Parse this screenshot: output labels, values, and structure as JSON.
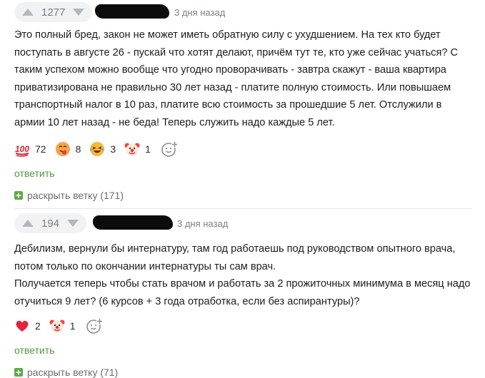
{
  "comments": [
    {
      "rating": "1277",
      "time": "3 дня назад",
      "text": "Это полный бред, закон не может иметь обратную силу с ухудшением. На тех кто будет поступать в августе 26 - пускай что хотят делают, причём тут те, кто уже сейчас учаться? С таким успехом можно вообще что угодно проворачивать - завтра скажут - ваша квартира приватизирована не правильно 30 лет назад - платите полную стоимость. Или повышаем транспортный налог в 10 раз, платите всю стоимость за прошедшие 5 лет. Отслужили в армии 10 лет назад - не беда! Теперь служить надо каждые 5 лет.",
      "reactions": [
        {
          "icon": "hundred-icon",
          "count": "72"
        },
        {
          "icon": "tongue-face-icon",
          "count": "8"
        },
        {
          "icon": "laughing-face-icon",
          "count": "3"
        },
        {
          "icon": "clown-face-icon",
          "count": "1"
        }
      ],
      "reply_label": "ответить",
      "expand_label": "раскрыть ветку (171)"
    },
    {
      "rating": "194",
      "time": "3 дня назад",
      "text_lines": [
        "Дебилизм, вернули бы интернатуру, там год работаешь под руководством опытного врача, потом только по окончании интернатуры ты сам врач.",
        "Получается теперь чтобы стать врачом и работать за 2 прожиточных минимума в месяц надо отучиться 9 лет? (6 курсов + 3 года отработка, если без аспирантуры)?"
      ],
      "reactions": [
        {
          "icon": "heart-icon",
          "count": "2"
        },
        {
          "icon": "clown-face-icon",
          "count": "1"
        }
      ],
      "reply_label": "ответить",
      "expand_label": "раскрыть ветку (71)"
    }
  ],
  "colors": {
    "accent_green": "#4f9a3a",
    "muted": "#7c7f84",
    "rating_bg": "#f1f2f4"
  }
}
